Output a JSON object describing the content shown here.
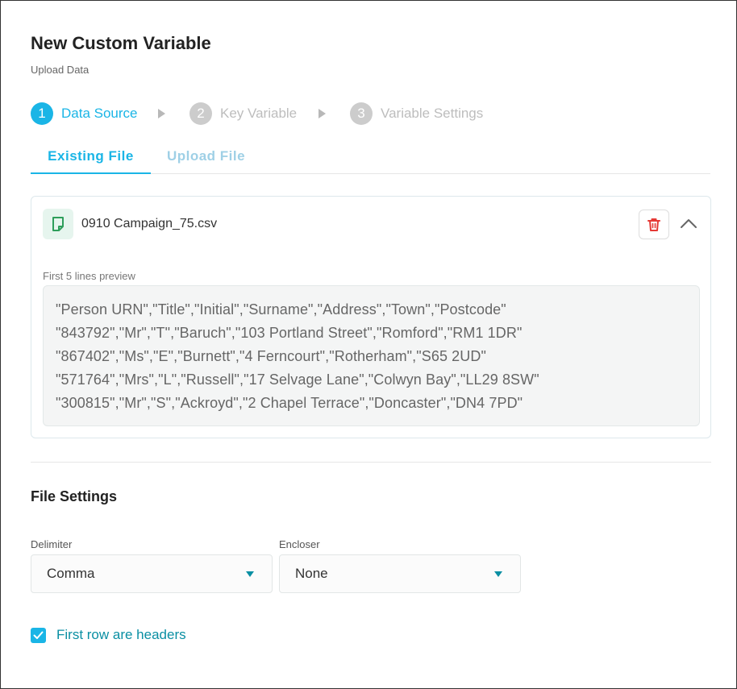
{
  "header": {
    "title": "New Custom Variable",
    "subtitle": "Upload Data"
  },
  "stepper": {
    "steps": [
      {
        "number": "1",
        "label": "Data Source",
        "state": "active"
      },
      {
        "number": "2",
        "label": "Key Variable",
        "state": "inactive"
      },
      {
        "number": "3",
        "label": "Variable Settings",
        "state": "inactive"
      }
    ]
  },
  "tabs": [
    {
      "label": "Existing File",
      "state": "active"
    },
    {
      "label": "Upload File",
      "state": "inactive"
    }
  ],
  "file": {
    "name": "0910 Campaign_75.csv",
    "icon": "file-icon",
    "delete_icon": "trash-icon",
    "collapse_icon": "chevron-up-icon",
    "preview_label": "First 5 lines preview",
    "preview_lines": [
      "\"Person URN\",\"Title\",\"Initial\",\"Surname\",\"Address\",\"Town\",\"Postcode\"",
      "\"843792\",\"Mr\",\"T\",\"Baruch\",\"103 Portland Street\",\"Romford\",\"RM1 1DR\"",
      "\"867402\",\"Ms\",\"E\",\"Burnett\",\"4 Ferncourt\",\"Rotherham\",\"S65 2UD\"",
      "\"571764\",\"Mrs\",\"L\",\"Russell\",\"17 Selvage Lane\",\"Colwyn Bay\",\"LL29 8SW\"",
      "\"300815\",\"Mr\",\"S\",\"Ackroyd\",\"2 Chapel Terrace\",\"Doncaster\",\"DN4 7PD\""
    ]
  },
  "file_settings": {
    "title": "File Settings",
    "delimiter": {
      "label": "Delimiter",
      "value": "Comma"
    },
    "encloser": {
      "label": "Encloser",
      "value": "None"
    },
    "headers_checkbox": {
      "label": "First row are headers",
      "checked": true
    }
  },
  "colors": {
    "accent": "#1ab5e6",
    "teal_text": "#0a8fa3",
    "delete": "#e53935",
    "file_icon": "#2e9e5b"
  }
}
